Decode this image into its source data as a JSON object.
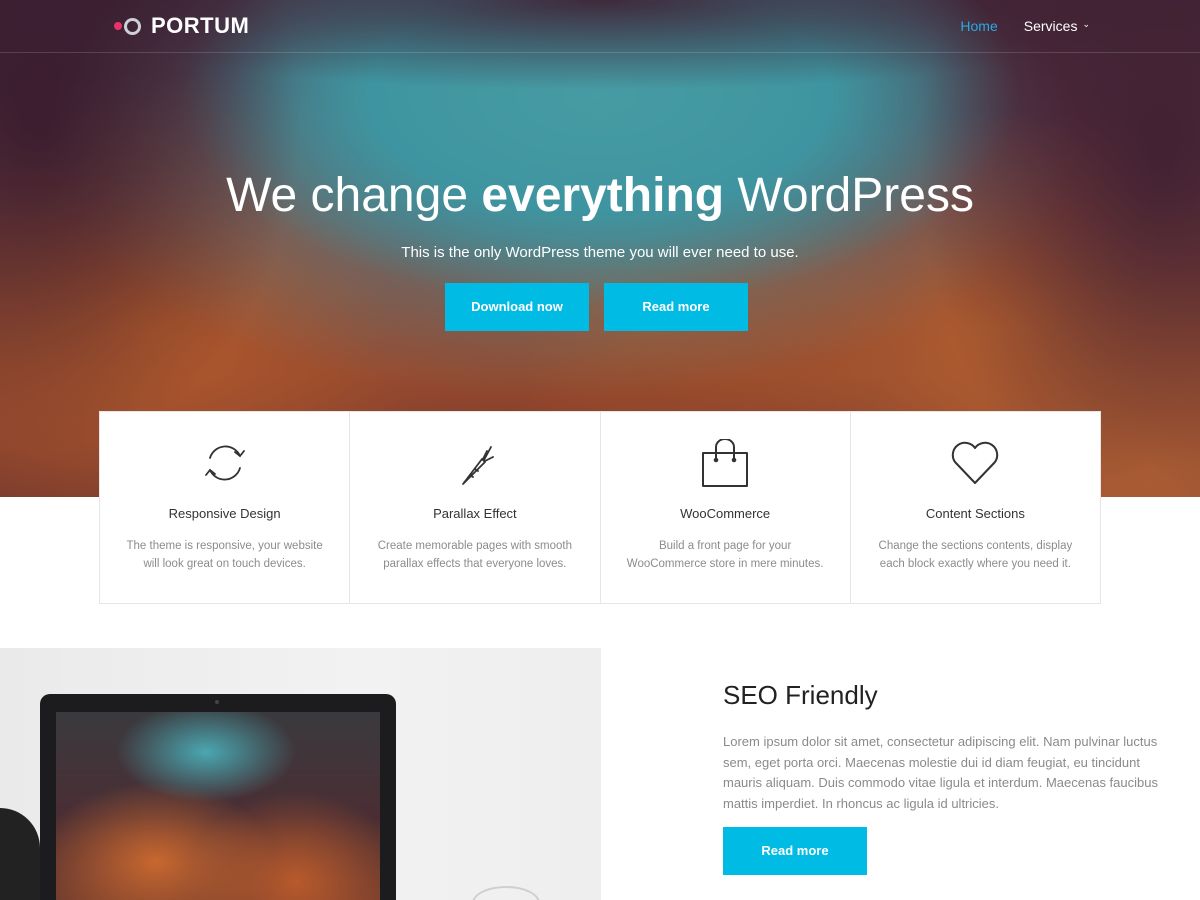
{
  "header": {
    "logo_text": "PORTUM",
    "nav": {
      "home": "Home",
      "services": "Services",
      "services_chevron": "⌄"
    }
  },
  "hero": {
    "title_pre": "We change ",
    "title_bold": "everything",
    "title_post": " WordPress",
    "subtitle": "This is the only WordPress theme you will ever need to use.",
    "buttons": {
      "download": "Download now",
      "read_more": "Read more"
    }
  },
  "features": [
    {
      "icon": "refresh-icon",
      "title": "Responsive Design",
      "desc": "The theme is responsive, your website will look great on touch devices."
    },
    {
      "icon": "carrot-icon",
      "title": "Parallax Effect",
      "desc": "Create memorable pages with smooth parallax effects that everyone loves."
    },
    {
      "icon": "shopping-bag-icon",
      "title": "WooCommerce",
      "desc": "Build a front page for your WooCommerce store in mere minutes."
    },
    {
      "icon": "heart-icon",
      "title": "Content Sections",
      "desc": "Change the sections contents, display each block exactly where you need it."
    }
  ],
  "seo": {
    "title": "SEO Friendly",
    "text": "Lorem ipsum dolor sit amet, consectetur adipiscing elit. Nam pulvinar luctus sem, eget porta orci. Maecenas molestie dui id diam feugiat, eu tincidunt mauris aliquam. Duis commodo vitae ligula et interdum. Maecenas faucibus mattis imperdiet. In rhoncus ac ligula id ultricies.",
    "button": "Read more"
  },
  "colors": {
    "accent": "#00bbe3",
    "nav_active": "#2aa9e0",
    "logo_dot": "#e8336a"
  }
}
